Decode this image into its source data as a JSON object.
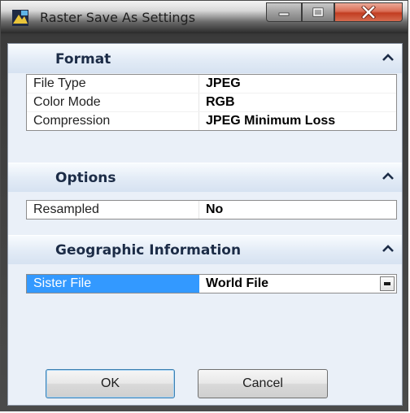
{
  "window": {
    "title": "Raster Save As Settings",
    "caption_buttons": [
      "minimize",
      "maximize",
      "close"
    ]
  },
  "sections": {
    "format": {
      "title": "Format",
      "rows": [
        {
          "name": "File Type",
          "value": "JPEG"
        },
        {
          "name": "Color Mode",
          "value": "RGB"
        },
        {
          "name": "Compression",
          "value": "JPEG Minimum Loss"
        }
      ]
    },
    "options": {
      "title": "Options",
      "rows": [
        {
          "name": "Resampled",
          "value": "No"
        }
      ]
    },
    "geo": {
      "title": "Geographic Information",
      "rows": [
        {
          "name": "Sister File",
          "value": "World File"
        }
      ]
    }
  },
  "buttons": {
    "ok_label": "OK",
    "cancel_label": "Cancel"
  },
  "icons": {
    "app": "app-icon",
    "collapse": "chevron-up-icon",
    "dropdown": "chevron-down-icon"
  },
  "colors": {
    "selection": "#3399ff",
    "header_text": "#1c2c47",
    "close_button": "#c23d21"
  }
}
